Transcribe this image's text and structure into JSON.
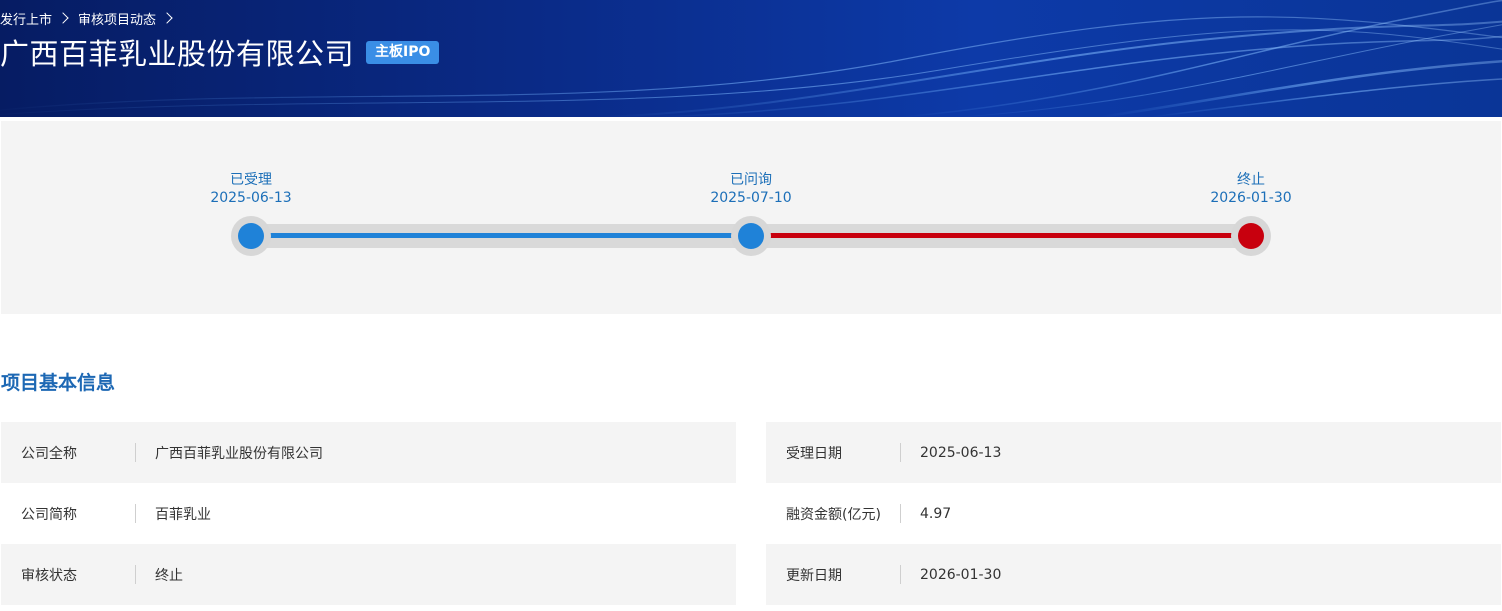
{
  "breadcrumb": [
    "发行上市",
    "审核项目动态"
  ],
  "header": {
    "title": "广西百菲乳业股份有限公司",
    "badge": "主板IPO"
  },
  "progress": {
    "stages": [
      {
        "name": "已受理",
        "date": "2025-06-13",
        "status": "completed"
      },
      {
        "name": "已问询",
        "date": "2025-07-10",
        "status": "completed"
      },
      {
        "name": "终止",
        "date": "2026-01-30",
        "status": "terminated"
      }
    ],
    "colors": {
      "completed": "#1f82d8",
      "terminated": "#c8000e",
      "track": "#d9d9d9",
      "label": "#1c6fb8"
    }
  },
  "basic_info": {
    "title": "项目基本信息",
    "rows": [
      {
        "label": "公司全称",
        "value": "广西百菲乳业股份有限公司"
      },
      {
        "label": "受理日期",
        "value": "2025-06-13"
      },
      {
        "label": "公司简称",
        "value": "百菲乳业"
      },
      {
        "label": "融资金额(亿元)",
        "value": "4.97"
      },
      {
        "label": "审核状态",
        "value": "终止"
      },
      {
        "label": "更新日期",
        "value": "2026-01-30"
      }
    ]
  },
  "icons": {
    "breadcrumb_separator": "chevron-right-icon"
  }
}
